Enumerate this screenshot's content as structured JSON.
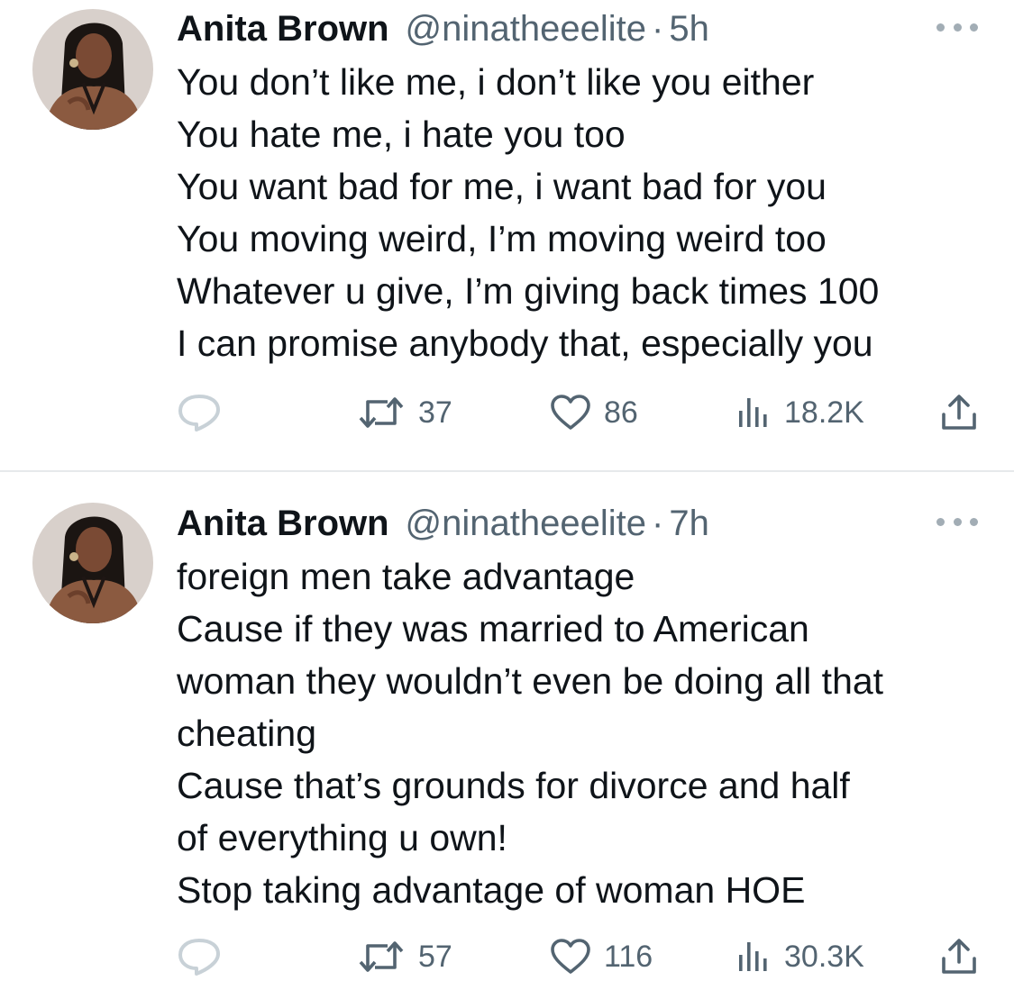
{
  "tweets": [
    {
      "author": {
        "name": "Anita Brown",
        "handle": "@ninatheeelite",
        "avatar_icon": "profile-photo"
      },
      "separator": "·",
      "time": "5h",
      "text_lines": [
        "You don’t like me, i don’t like you either",
        "You hate me, i hate you too",
        "You want bad for me, i want bad for you",
        "You moving weird, I’m moving weird too",
        "Whatever u give, I’m giving back times 100",
        "I can promise anybody that, especially you"
      ],
      "stats": {
        "retweets": "37",
        "likes": "86",
        "views": "18.2K"
      }
    },
    {
      "author": {
        "name": "Anita Brown",
        "handle": "@ninatheeelite",
        "avatar_icon": "profile-photo"
      },
      "separator": "·",
      "time": "7h",
      "text_lines": [
        "foreign men take advantage",
        "Cause if they was married to American",
        "woman they wouldn’t even be doing all that",
        "cheating",
        "Cause that’s grounds for divorce and half",
        "of everything u own!",
        "Stop taking advantage of woman HOE"
      ],
      "stats": {
        "retweets": "57",
        "likes": "116",
        "views": "30.3K"
      }
    }
  ],
  "icons": {
    "more": "more-horizontal-icon",
    "reply": "reply-icon",
    "retweet": "retweet-icon",
    "like": "heart-icon",
    "views": "views-icon",
    "share": "share-icon"
  },
  "colors": {
    "text_primary": "#0f1419",
    "text_secondary": "#536471",
    "divider": "#e6e9eb",
    "muted_icon": "#a2adb5"
  }
}
